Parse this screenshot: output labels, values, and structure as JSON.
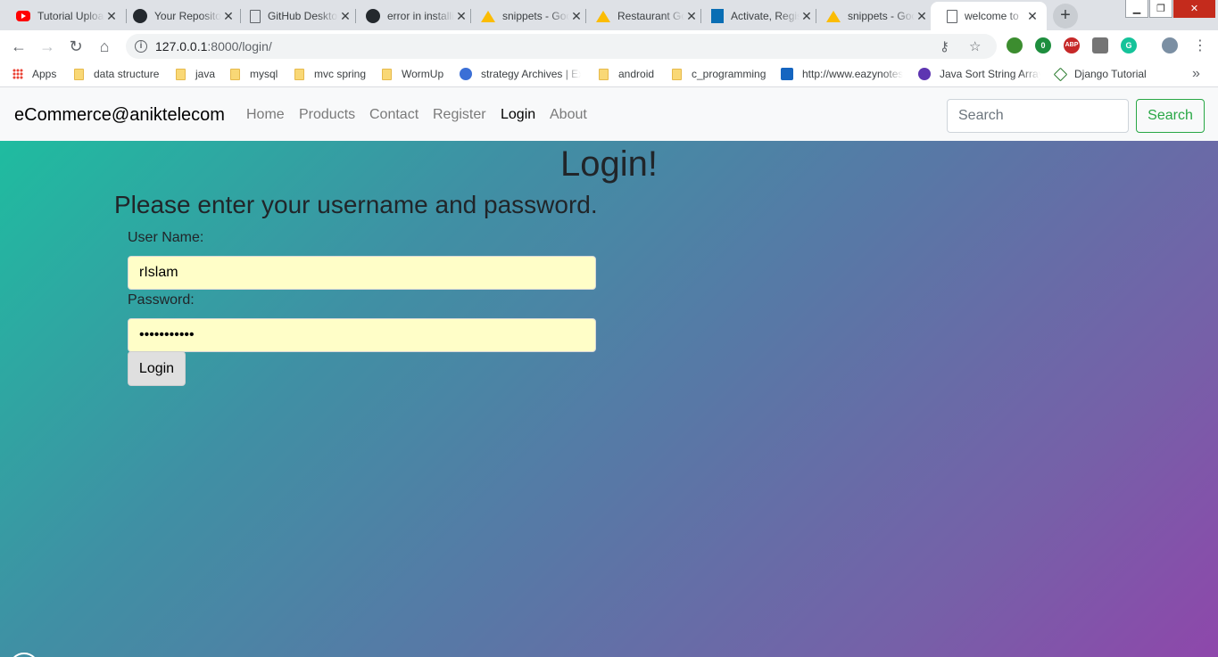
{
  "browser": {
    "tabs": [
      {
        "title": "Tutorial Upload",
        "icon": "youtube-icon"
      },
      {
        "title": "Your Repositories",
        "icon": "github-icon"
      },
      {
        "title": "GitHub Desktop",
        "icon": "document-icon"
      },
      {
        "title": "error in installing",
        "icon": "github-icon"
      },
      {
        "title": "snippets - Google Drive",
        "icon": "google-drive-icon"
      },
      {
        "title": "Restaurant Google Drive",
        "icon": "google-drive-icon"
      },
      {
        "title": "Activate, Register",
        "icon": "activate-icon"
      },
      {
        "title": "snippets - Google Drive",
        "icon": "google-drive-icon"
      },
      {
        "title": "welcome to",
        "icon": "document-icon"
      }
    ],
    "url_host": "127.0.0.1",
    "url_rest": ":8000/login/",
    "bookmarks": {
      "apps": "Apps",
      "items": [
        "data structure",
        "java",
        "mysql",
        "mvc spring",
        "WormUp",
        "strategy Archives | Ex",
        "android",
        "c_programming",
        "http://www.eazynotes",
        "Java Sort String Array",
        "Django Tutorial"
      ]
    },
    "extension_badge": "0"
  },
  "navbar": {
    "brand": "eCommerce@aniktelecom",
    "links": [
      "Home",
      "Products",
      "Contact",
      "Register",
      "Login",
      "About"
    ],
    "search_placeholder": "Search",
    "search_button": "Search"
  },
  "login": {
    "title": "Login!",
    "subtitle": "Please enter your username and password.",
    "username_label": "User Name:",
    "username_value": "rIslam",
    "password_label": "Password:",
    "password_value": "•••••••••••",
    "button": "Login"
  },
  "colors": {
    "gradient_start": "#1fbca0",
    "gradient_end": "#8e47ab",
    "search_accent": "#28a745",
    "field_background": "#fffec8"
  }
}
